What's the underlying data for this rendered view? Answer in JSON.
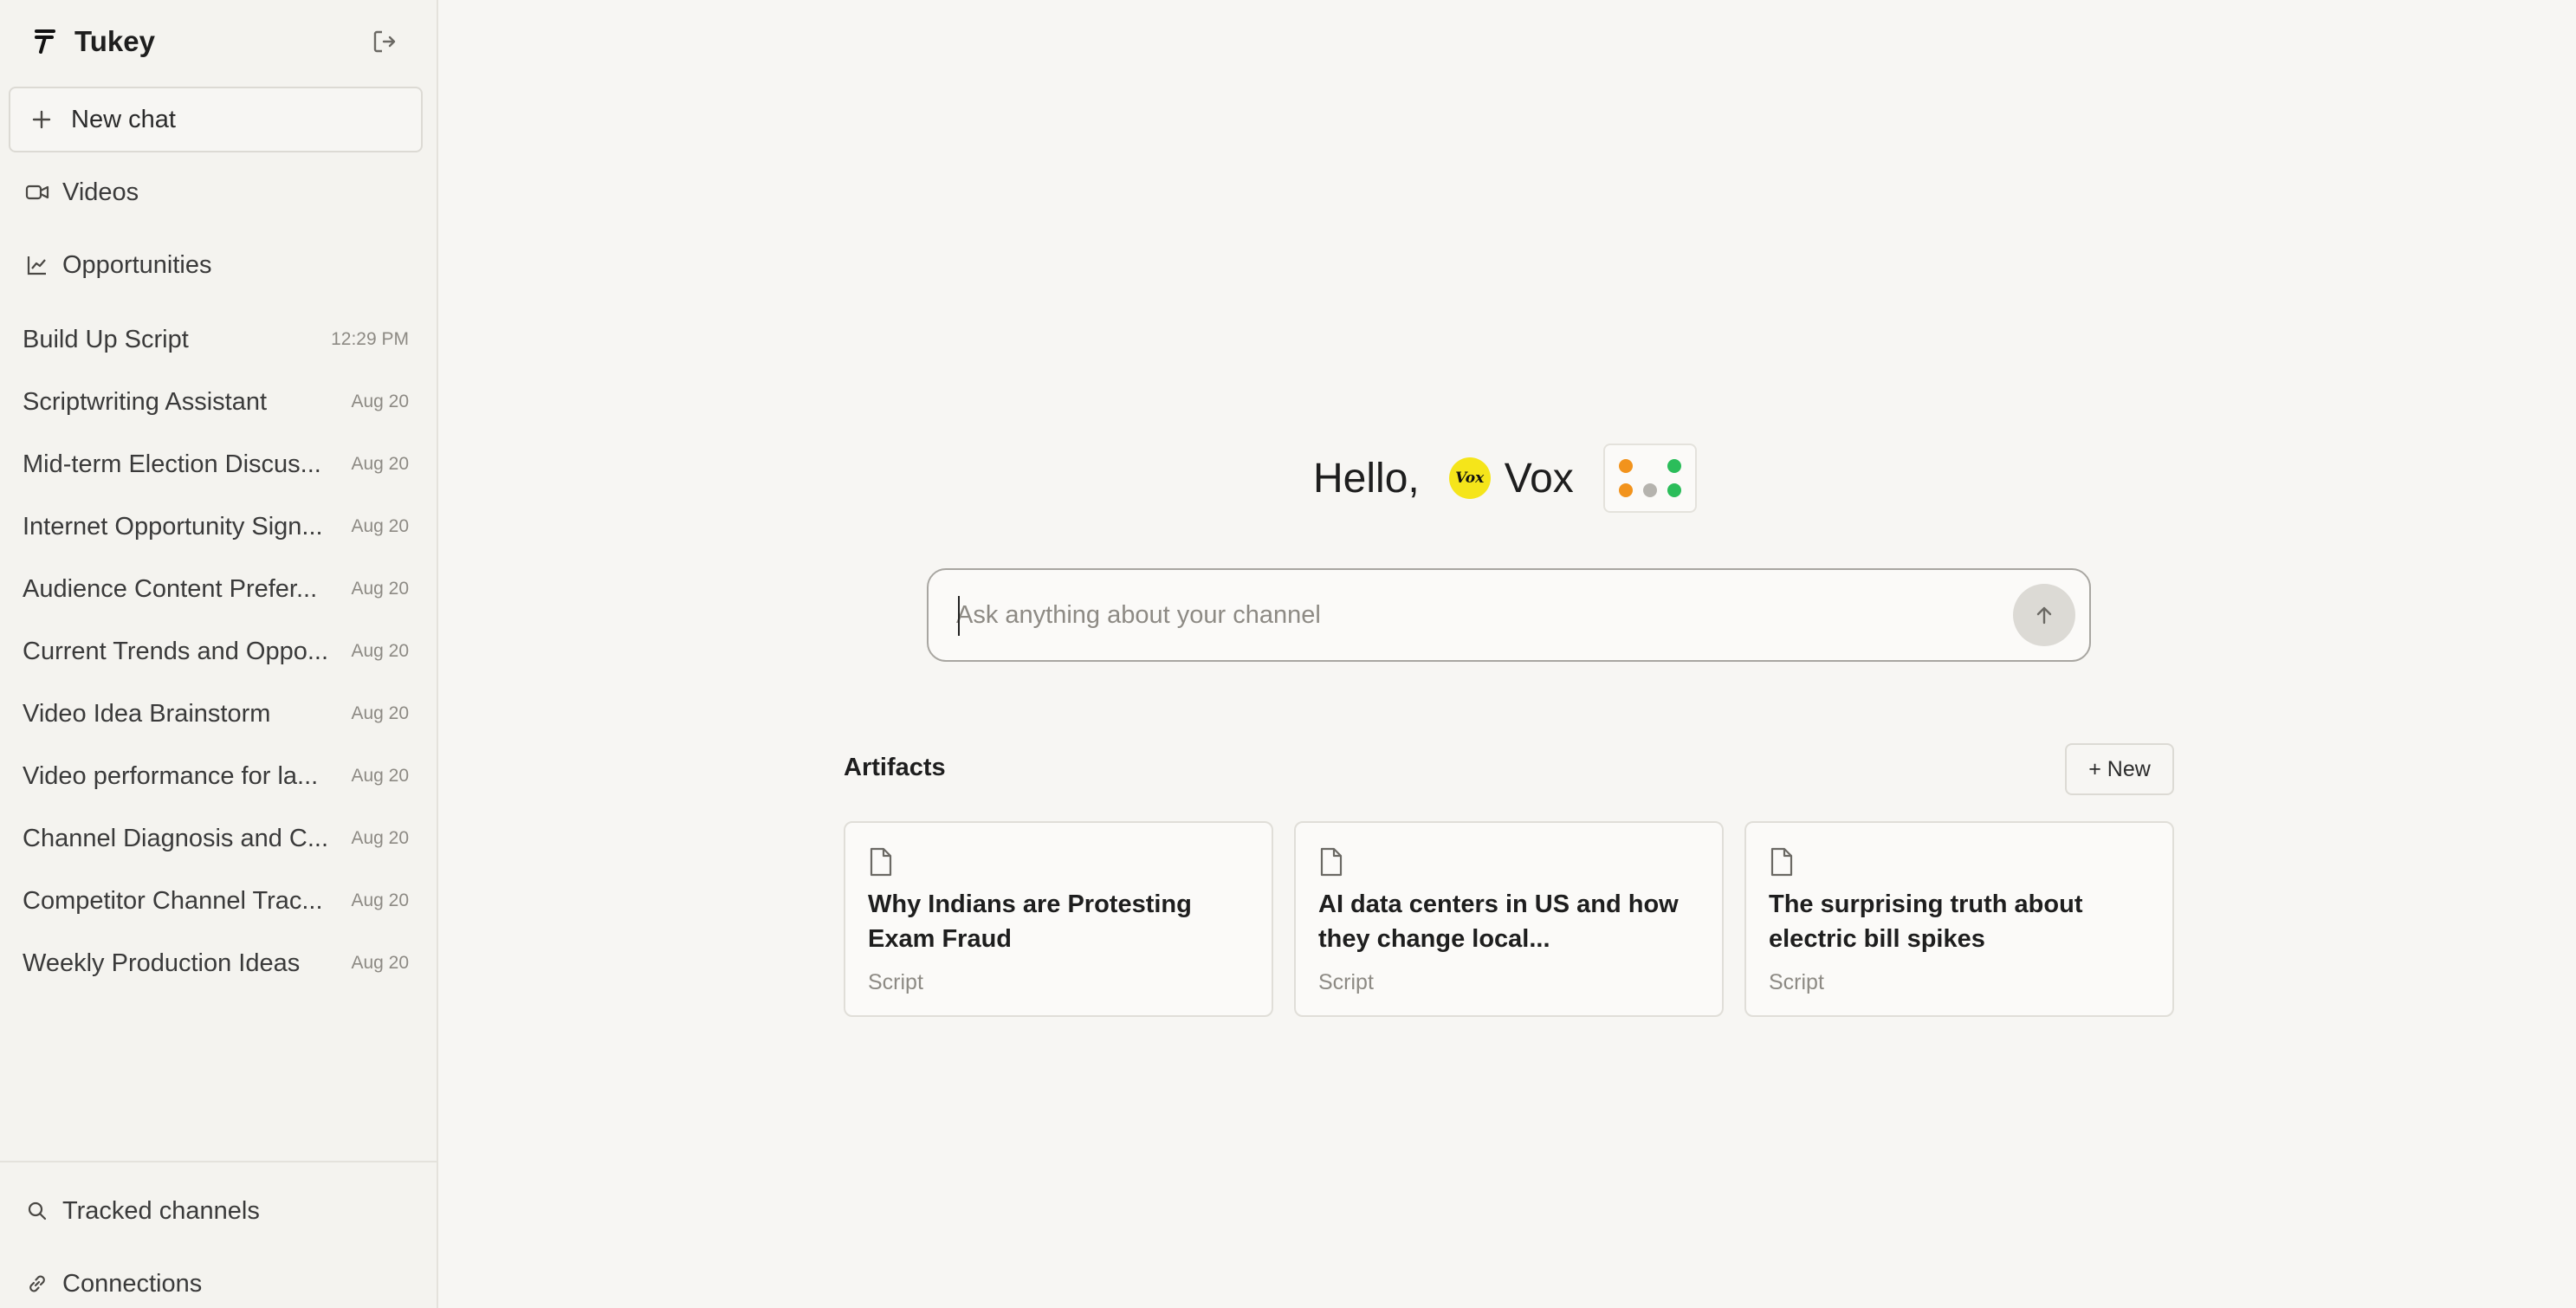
{
  "app": {
    "name": "Tukey"
  },
  "sidebar": {
    "new_chat_label": "New chat",
    "nav": [
      {
        "label": "Videos",
        "icon": "video-camera-icon"
      },
      {
        "label": "Opportunities",
        "icon": "line-chart-icon"
      }
    ],
    "chats": [
      {
        "title": "Build Up Script",
        "time": "12:29 PM"
      },
      {
        "title": "Scriptwriting Assistant",
        "time": "Aug 20"
      },
      {
        "title": "Mid-term Election Discus...",
        "time": "Aug 20"
      },
      {
        "title": "Internet Opportunity Sign...",
        "time": "Aug 20"
      },
      {
        "title": "Audience Content Prefer...",
        "time": "Aug 20"
      },
      {
        "title": "Current Trends and Oppo...",
        "time": "Aug 20"
      },
      {
        "title": "Video Idea Brainstorm",
        "time": "Aug 20"
      },
      {
        "title": "Video performance for la...",
        "time": "Aug 20"
      },
      {
        "title": "Channel Diagnosis and C...",
        "time": "Aug 20"
      },
      {
        "title": "Competitor Channel Trac...",
        "time": "Aug 20"
      },
      {
        "title": "Weekly Production Ideas",
        "time": "Aug 20"
      }
    ],
    "footer": [
      {
        "label": "Tracked channels",
        "icon": "search-icon"
      },
      {
        "label": "Connections",
        "icon": "link-icon"
      }
    ]
  },
  "main": {
    "greeting": "Hello,",
    "channel_logo_text": "Vox",
    "channel_name": "Vox",
    "search_placeholder": "Ask anything about your channel",
    "artifacts_heading": "Artifacts",
    "new_artifact_label": "+ New",
    "artifacts": [
      {
        "title": "Why Indians are Protesting Exam Fraud",
        "type": "Script"
      },
      {
        "title": "AI data centers in US and how they change local...",
        "type": "Script"
      },
      {
        "title": "The surprising truth about electric bill spikes",
        "type": "Script"
      }
    ]
  },
  "colors": {
    "background": "#f7f6f3",
    "sidebar": "#f4f3ef",
    "vox_yellow": "#f5e51a",
    "dot_orange": "#f2931c",
    "dot_green": "#2bbd5a",
    "dot_gray": "#b5b3ae"
  }
}
